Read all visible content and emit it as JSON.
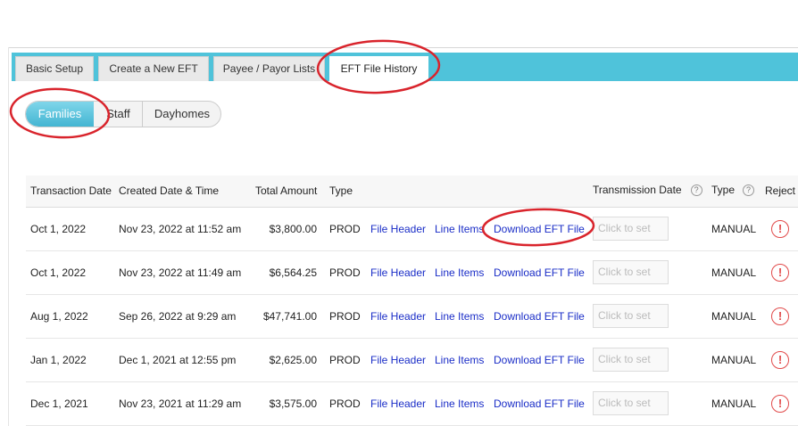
{
  "tabs": [
    {
      "label": "Basic Setup"
    },
    {
      "label": "Create a New EFT"
    },
    {
      "label": "Payee / Payor Lists"
    },
    {
      "label": "EFT File History"
    }
  ],
  "segments": [
    {
      "label": "Families"
    },
    {
      "label": "Staff"
    },
    {
      "label": "Dayhomes"
    }
  ],
  "table": {
    "headers": {
      "transaction_date": "Transaction Date",
      "created": "Created Date & Time",
      "amount": "Total Amount",
      "type": "Type",
      "transmission_date": "Transmission Date",
      "type2": "Type",
      "reject": "Reject"
    },
    "help_glyph": "?",
    "rows": [
      {
        "transaction_date": "Oct 1, 2022",
        "created": "Nov 23, 2022 at 11:52 am",
        "amount": "$3,800.00",
        "type": "PROD",
        "file_header": "File Header",
        "line_items": "Line Items",
        "download": "Download EFT File",
        "transmission_placeholder": "Click to set",
        "type2": "MANUAL",
        "reject_glyph": "!"
      },
      {
        "transaction_date": "Oct 1, 2022",
        "created": "Nov 23, 2022 at 11:49 am",
        "amount": "$6,564.25",
        "type": "PROD",
        "file_header": "File Header",
        "line_items": "Line Items",
        "download": "Download EFT File",
        "transmission_placeholder": "Click to set",
        "type2": "MANUAL",
        "reject_glyph": "!"
      },
      {
        "transaction_date": "Aug 1, 2022",
        "created": "Sep 26, 2022 at 9:29 am",
        "amount": "$47,741.00",
        "type": "PROD",
        "file_header": "File Header",
        "line_items": "Line Items",
        "download": "Download EFT File",
        "transmission_placeholder": "Click to set",
        "type2": "MANUAL",
        "reject_glyph": "!"
      },
      {
        "transaction_date": "Jan 1, 2022",
        "created": "Dec 1, 2021 at 12:55 pm",
        "amount": "$2,625.00",
        "type": "PROD",
        "file_header": "File Header",
        "line_items": "Line Items",
        "download": "Download EFT File",
        "transmission_placeholder": "Click to set",
        "type2": "MANUAL",
        "reject_glyph": "!"
      },
      {
        "transaction_date": "Dec 1, 2021",
        "created": "Nov 23, 2021 at 11:29 am",
        "amount": "$3,575.00",
        "type": "PROD",
        "file_header": "File Header",
        "line_items": "Line Items",
        "download": "Download EFT File",
        "transmission_placeholder": "Click to set",
        "type2": "MANUAL",
        "reject_glyph": "!"
      }
    ]
  },
  "colors": {
    "tabbar": "#4fc3da",
    "link": "#1a2dc7",
    "annotation": "#d9242c",
    "reject": "#e14a4a"
  },
  "icons": {
    "help": "question-circle-icon",
    "reject": "exclamation-circle-icon"
  }
}
